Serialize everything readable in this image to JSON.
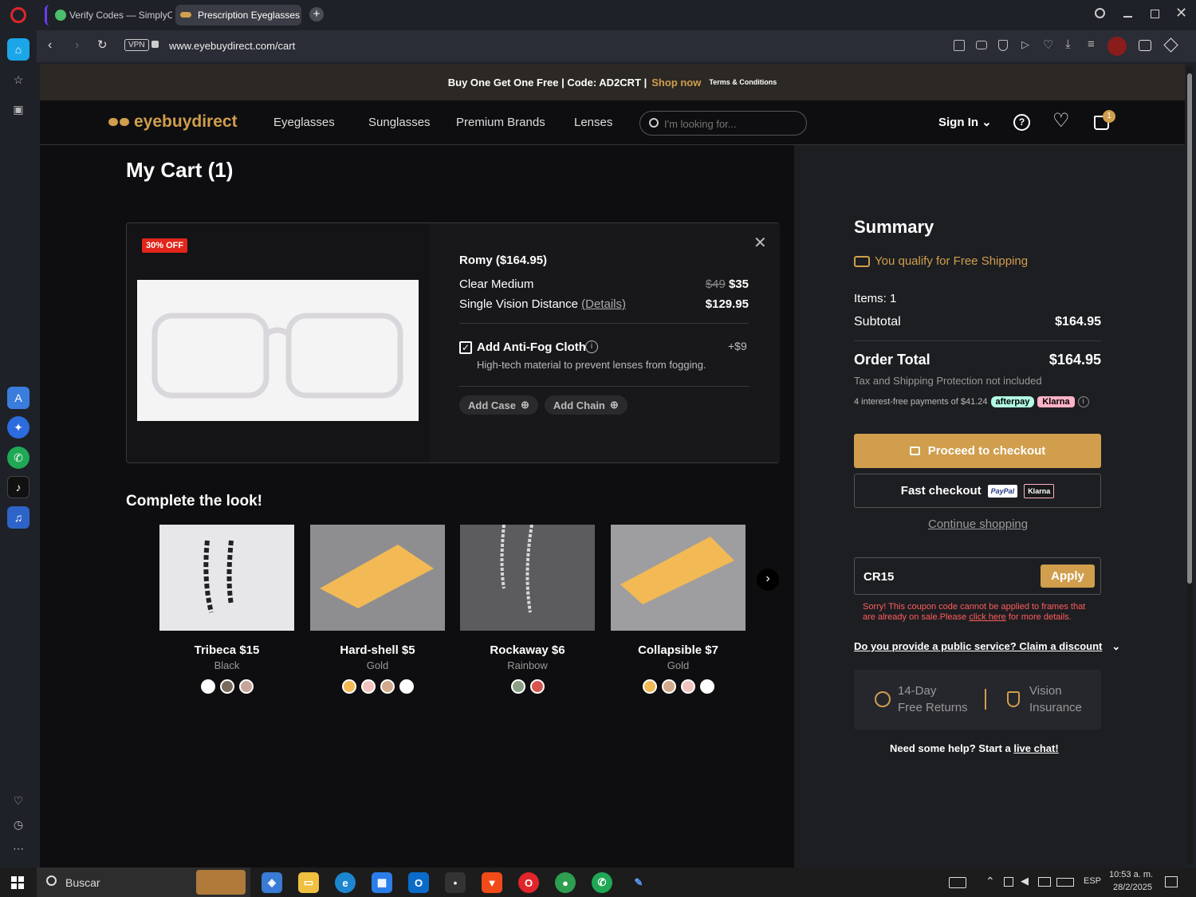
{
  "browser": {
    "tabs": [
      {
        "label": "Verify Codes — SimplyCo"
      },
      {
        "label": "Prescription Eyeglasses Or"
      }
    ],
    "url": "www.eyebuydirect.com/cart",
    "vpn_label": "VPN"
  },
  "promo": {
    "text": "Buy One Get One Free | Code: AD2CRT |",
    "shop_now": "Shop now",
    "terms": "Terms & Conditions"
  },
  "nav": {
    "logo": "eyebuydirect",
    "links": [
      "Eyeglasses",
      "Sunglasses",
      "Premium Brands",
      "Lenses"
    ],
    "search_placeholder": "I'm looking for...",
    "sign_in": "Sign In",
    "cart_count": "1"
  },
  "cart": {
    "title": "My Cart (1)",
    "badge": "30% OFF",
    "item_name": "Romy ($164.95)",
    "lines": [
      {
        "label": "Clear Medium",
        "old_price": "$49",
        "price": "$35"
      },
      {
        "label": "Single Vision Distance",
        "link": "(Details)",
        "price": "$129.95"
      }
    ],
    "addon": {
      "label": "Add Anti-Fog Cloth",
      "price": "+$9",
      "desc": "High-tech material to prevent lenses from fogging.",
      "checked": true
    },
    "add_case": "Add Case",
    "add_chain": "Add Chain"
  },
  "complete_look": {
    "title": "Complete the look!",
    "products": [
      {
        "name": "Tribeca $15",
        "color": "Black",
        "swatches": [
          "#ffffff",
          "#7a6a5e",
          "#c7a59a"
        ]
      },
      {
        "name": "Hard-shell $5",
        "color": "Gold",
        "swatches": [
          "#f2b955",
          "#f3c3bf",
          "#d2a98a",
          "#ffffff"
        ]
      },
      {
        "name": "Rockaway $6",
        "color": "Rainbow",
        "swatches": [
          "#8a9f85",
          "#d6554f"
        ]
      },
      {
        "name": "Collapsible $7",
        "color": "Gold",
        "swatches": [
          "#f2b955",
          "#d2a98a",
          "#f3c3bf",
          "#ffffff"
        ]
      }
    ]
  },
  "summary": {
    "title": "Summary",
    "free_shipping": "You qualify for Free Shipping",
    "items": "Items: 1",
    "subtotal_label": "Subtotal",
    "subtotal": "$164.95",
    "order_total_label": "Order Total",
    "order_total": "$164.95",
    "tax_note": "Tax and Shipping Protection not included",
    "installments": "4 interest-free payments of $41.24",
    "afterpay": "afterpay",
    "klarna": "Klarna",
    "checkout": "Proceed to checkout",
    "fast_checkout": "Fast checkout",
    "paypal": "PayPal",
    "continue": "Continue shopping",
    "coupon_value": "CR15",
    "apply": "Apply",
    "error_a": "Sorry! This coupon code cannot be applied to frames that are already on sale.Please ",
    "error_link": "click here",
    "error_b": " for more details.",
    "public_service": "Do you provide a public service? Claim a discount",
    "returns_line1": "14-Day",
    "returns_line2": "Free Returns",
    "insurance_line1": "Vision",
    "insurance_line2": "Insurance",
    "help_text": "Need some help? Start a ",
    "help_link": "live chat!"
  },
  "taskbar": {
    "search": "Buscar",
    "lang": "ESP",
    "time": "10:53 a. m.",
    "date": "28/2/2025"
  },
  "colors": {
    "accent": "#d09e4d",
    "error": "#ff5c5c",
    "badge": "#e1251b"
  }
}
